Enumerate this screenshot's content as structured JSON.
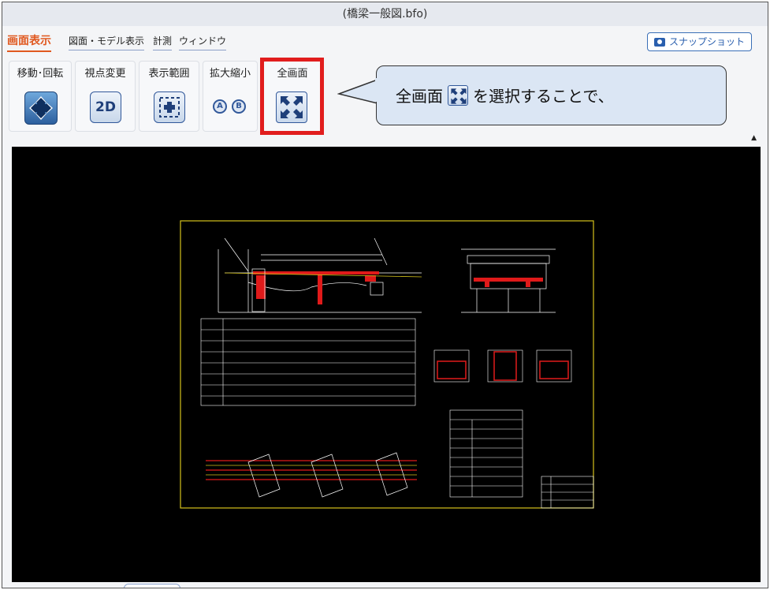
{
  "window": {
    "title": "(橋梁一般図.bfo)"
  },
  "menu": {
    "items": [
      {
        "label": "画面表示",
        "active": true
      },
      {
        "label": "図面・モデル表示",
        "active": false
      },
      {
        "label": "計測",
        "active": false
      },
      {
        "label": "ウィンドウ",
        "active": false
      }
    ]
  },
  "snapshot": {
    "label": "スナップショット",
    "icon": "camera-icon"
  },
  "toolbar": {
    "groups": [
      {
        "label": "移動･回転",
        "icon": "move-arrows-icon"
      },
      {
        "label": "視点変更",
        "icon": "view-2d-icon",
        "icon_text": "2D"
      },
      {
        "label": "表示範囲",
        "icon": "display-range-icon"
      },
      {
        "label": "拡大縮小",
        "icons": [
          {
            "name": "zoom-a-icon",
            "text": "A"
          },
          {
            "name": "zoom-b-icon",
            "text": "B"
          }
        ]
      },
      {
        "label": "全画面",
        "icon": "fullscreen-icon"
      }
    ]
  },
  "callout": {
    "text_before": "全画面",
    "text_after": "を選択することで、"
  },
  "colors": {
    "active_menu": "#e0581f",
    "highlight": "#e11d1d",
    "callout_bg": "#dbe6f4",
    "viewport_bg": "#000000",
    "drawing_border": "#d4c21a",
    "drawing_lines": "#ffffff",
    "drawing_red": "#e01a1a"
  }
}
